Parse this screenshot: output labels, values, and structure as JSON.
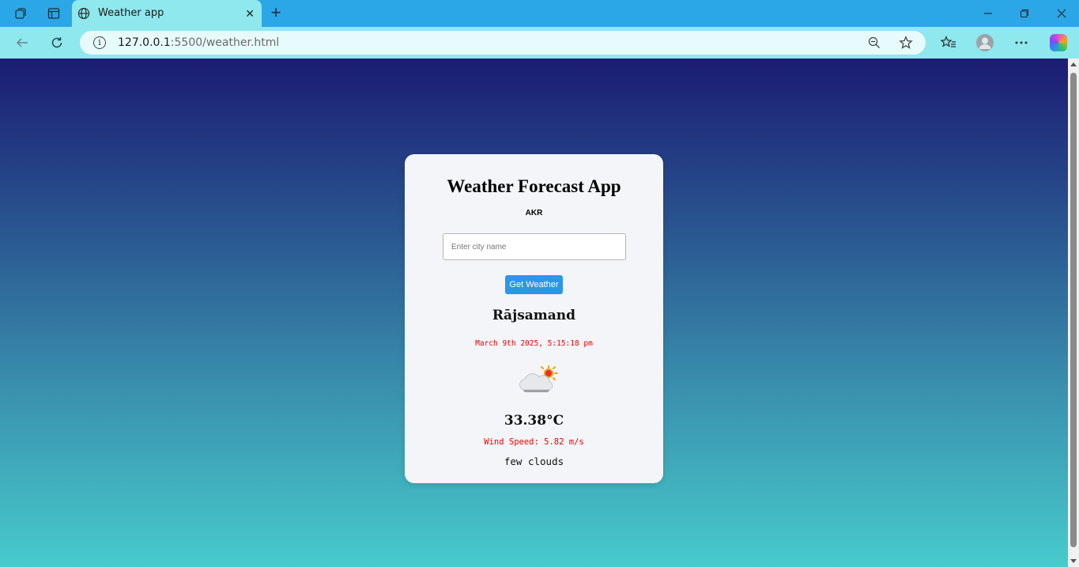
{
  "browser": {
    "tab_title": "Weather app",
    "url_host": "127.0.0.1",
    "url_rest": ":5500/weather.html",
    "icons": [
      "workspaces-icon",
      "tab-actions-icon",
      "globe-icon",
      "close-icon",
      "new-tab-icon",
      "minimize-icon",
      "restore-icon",
      "window-close-icon",
      "back-icon",
      "refresh-icon",
      "info-icon",
      "zoom-out-icon",
      "favorite-star-icon",
      "favorites-icon",
      "profile-icon",
      "more-icon",
      "copilot-icon"
    ]
  },
  "app": {
    "title": "Weather Forecast App",
    "subtitle": "AKR",
    "city_input_placeholder": "Enter city name",
    "city_input_value": "",
    "button_label": "Get Weather",
    "city": "Rājsamand",
    "datetime": "March 9th 2025, 5:15:18 pm",
    "weather_icon": "sun-behind-cloud-icon",
    "temperature": "33.38°C",
    "wind": "Wind Speed: 5.82 m/s",
    "description": "few clouds"
  },
  "colors": {
    "gradient_top": "#1b1c73",
    "gradient_bottom": "#46cbcc",
    "button": "#2c96e8",
    "accent_text": "#ee0000"
  }
}
